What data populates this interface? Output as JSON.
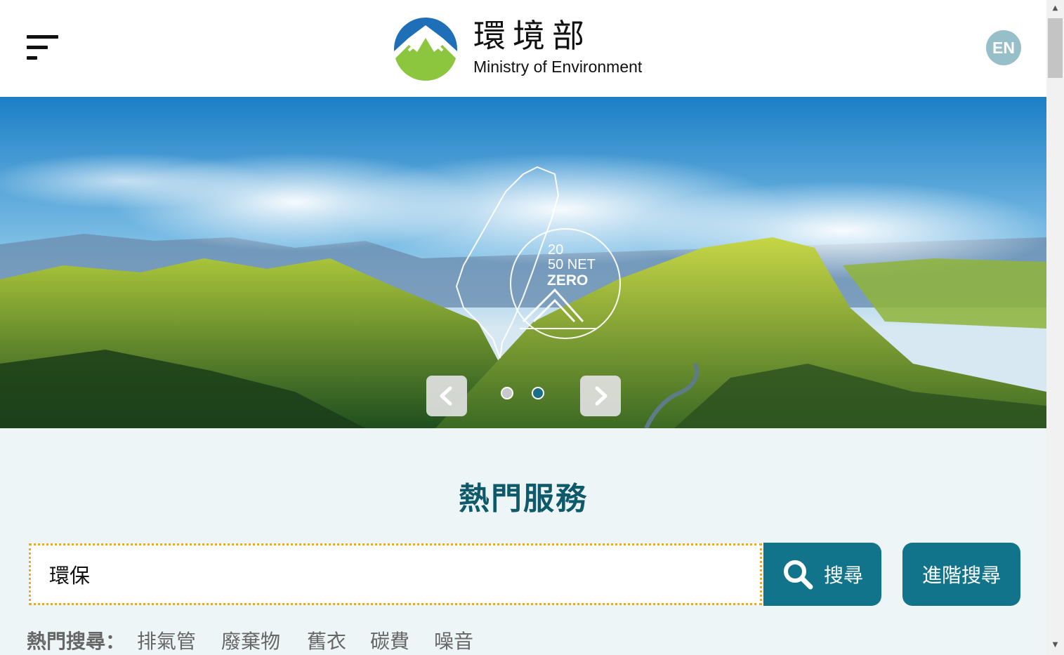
{
  "header": {
    "logo_zh": "環境部",
    "logo_en": "Ministry of Environment",
    "lang_label": "EN"
  },
  "banner": {
    "badge_line1": "20",
    "badge_line2": "50 NET",
    "badge_line3": "ZERO",
    "slides_total": 2,
    "active_slide": 2
  },
  "main": {
    "section_title": "熱門服務",
    "search_value": "環保",
    "search_button": "搜尋",
    "advanced_button": "進階搜尋",
    "hot_label": "熱門搜尋：",
    "hot_terms": [
      "排氣管",
      "廢棄物",
      "舊衣",
      "碳費",
      "噪音"
    ]
  },
  "colors": {
    "primary": "#11748a",
    "title": "#0e5a6a",
    "section_bg": "#edf5f6",
    "input_border": "#e8a930",
    "lang_bg": "#97bfc9"
  }
}
